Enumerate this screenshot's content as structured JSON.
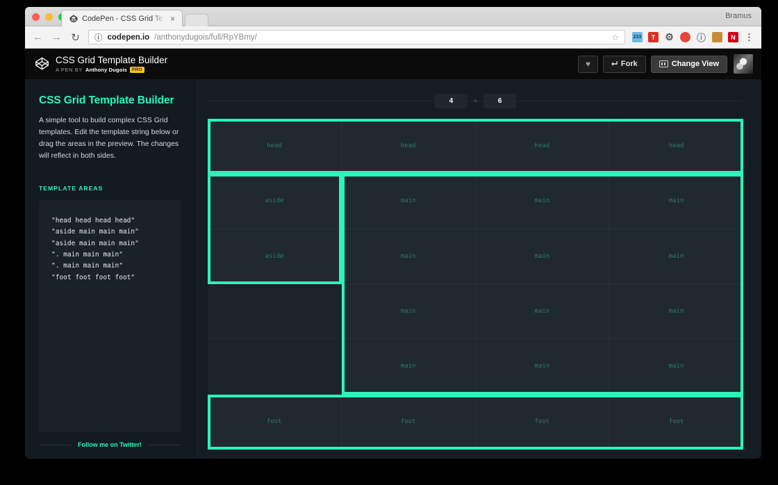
{
  "browser": {
    "profile_name": "Bramus",
    "tab_title": "CodePen - CSS Grid Template",
    "tab_close": "×",
    "back": "←",
    "forward": "→",
    "reload": "↻",
    "info_icon": "ⓘ",
    "url_domain": "codepen.io",
    "url_path": "/anthonydugois/full/RpYBmy/",
    "star": "☆",
    "extensions": [
      "233",
      "T",
      "⚙",
      "●",
      "ⓘ",
      "■",
      "N",
      "⋮"
    ]
  },
  "pen_header": {
    "title": "CSS Grid Template Builder",
    "pen_by": "A PEN BY",
    "author": "Anthony Dugois",
    "pro": "PRO",
    "heart": "♥",
    "fork_label": "Fork",
    "fork_icon": "⮠",
    "change_view_label": "Change View"
  },
  "sidebar": {
    "title": "CSS Grid Template Builder",
    "description": "A simple tool to build complex CSS Grid templates. Edit the template string below or drag the areas in the preview. The changes will reflect in both sides.",
    "areas_label": "TEMPLATE AREAS",
    "areas_value": "\"head head head head\"\n\"aside main main main\"\n\"aside main main main\"\n\". main main main\"\n\". main main main\"\n\"foot foot foot foot\"",
    "twitter_link": "Follow me on Twitter!"
  },
  "preview": {
    "columns_value": "4",
    "rows_value": "6",
    "separator": "×",
    "grid": {
      "columns": 4,
      "rows": 6,
      "cells": [
        [
          "head",
          "head",
          "head",
          "head"
        ],
        [
          "aside",
          "main",
          "main",
          "main"
        ],
        [
          "aside",
          "main",
          "main",
          "main"
        ],
        [
          ".",
          "main",
          "main",
          "main"
        ],
        [
          ".",
          "main",
          "main",
          "main"
        ],
        [
          "foot",
          "foot",
          "foot",
          "foot"
        ]
      ],
      "areas": [
        {
          "name": "head",
          "col_start": 1,
          "col_end": 5,
          "row_start": 1,
          "row_end": 2
        },
        {
          "name": "aside",
          "col_start": 1,
          "col_end": 2,
          "row_start": 2,
          "row_end": 4
        },
        {
          "name": "main",
          "col_start": 2,
          "col_end": 5,
          "row_start": 2,
          "row_end": 6
        },
        {
          "name": "foot",
          "col_start": 1,
          "col_end": 5,
          "row_start": 6,
          "row_end": 7
        }
      ]
    }
  },
  "colors": {
    "accent": "#2af5b8",
    "cell_bg": "#20292f",
    "page_bg": "#151d23",
    "label_text": "#2e7a68"
  }
}
